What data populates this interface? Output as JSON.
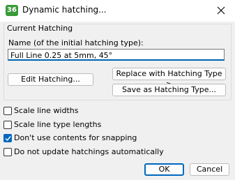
{
  "window": {
    "icon_text": "36",
    "title": "Dynamic hatching..."
  },
  "group": {
    "title": "Current Hatching",
    "name_label": "Name (of the initial hatching type):",
    "name_value": "Full Line 0.25 at 5mm, 45°"
  },
  "buttons": {
    "edit": "Edit Hatching...",
    "replace": "Replace with Hatching Type >",
    "save": "Save as Hatching Type...",
    "ok": "OK",
    "cancel": "Cancel"
  },
  "options": [
    {
      "label": "Scale line widths",
      "checked": false
    },
    {
      "label": "Scale line type lengths",
      "checked": false
    },
    {
      "label": "Don't use contents for snapping",
      "checked": true
    },
    {
      "label": "Do not update hatchings automatically",
      "checked": false
    }
  ],
  "colors": {
    "accent": "#0067c0",
    "app_icon": "#3a9a3a"
  }
}
